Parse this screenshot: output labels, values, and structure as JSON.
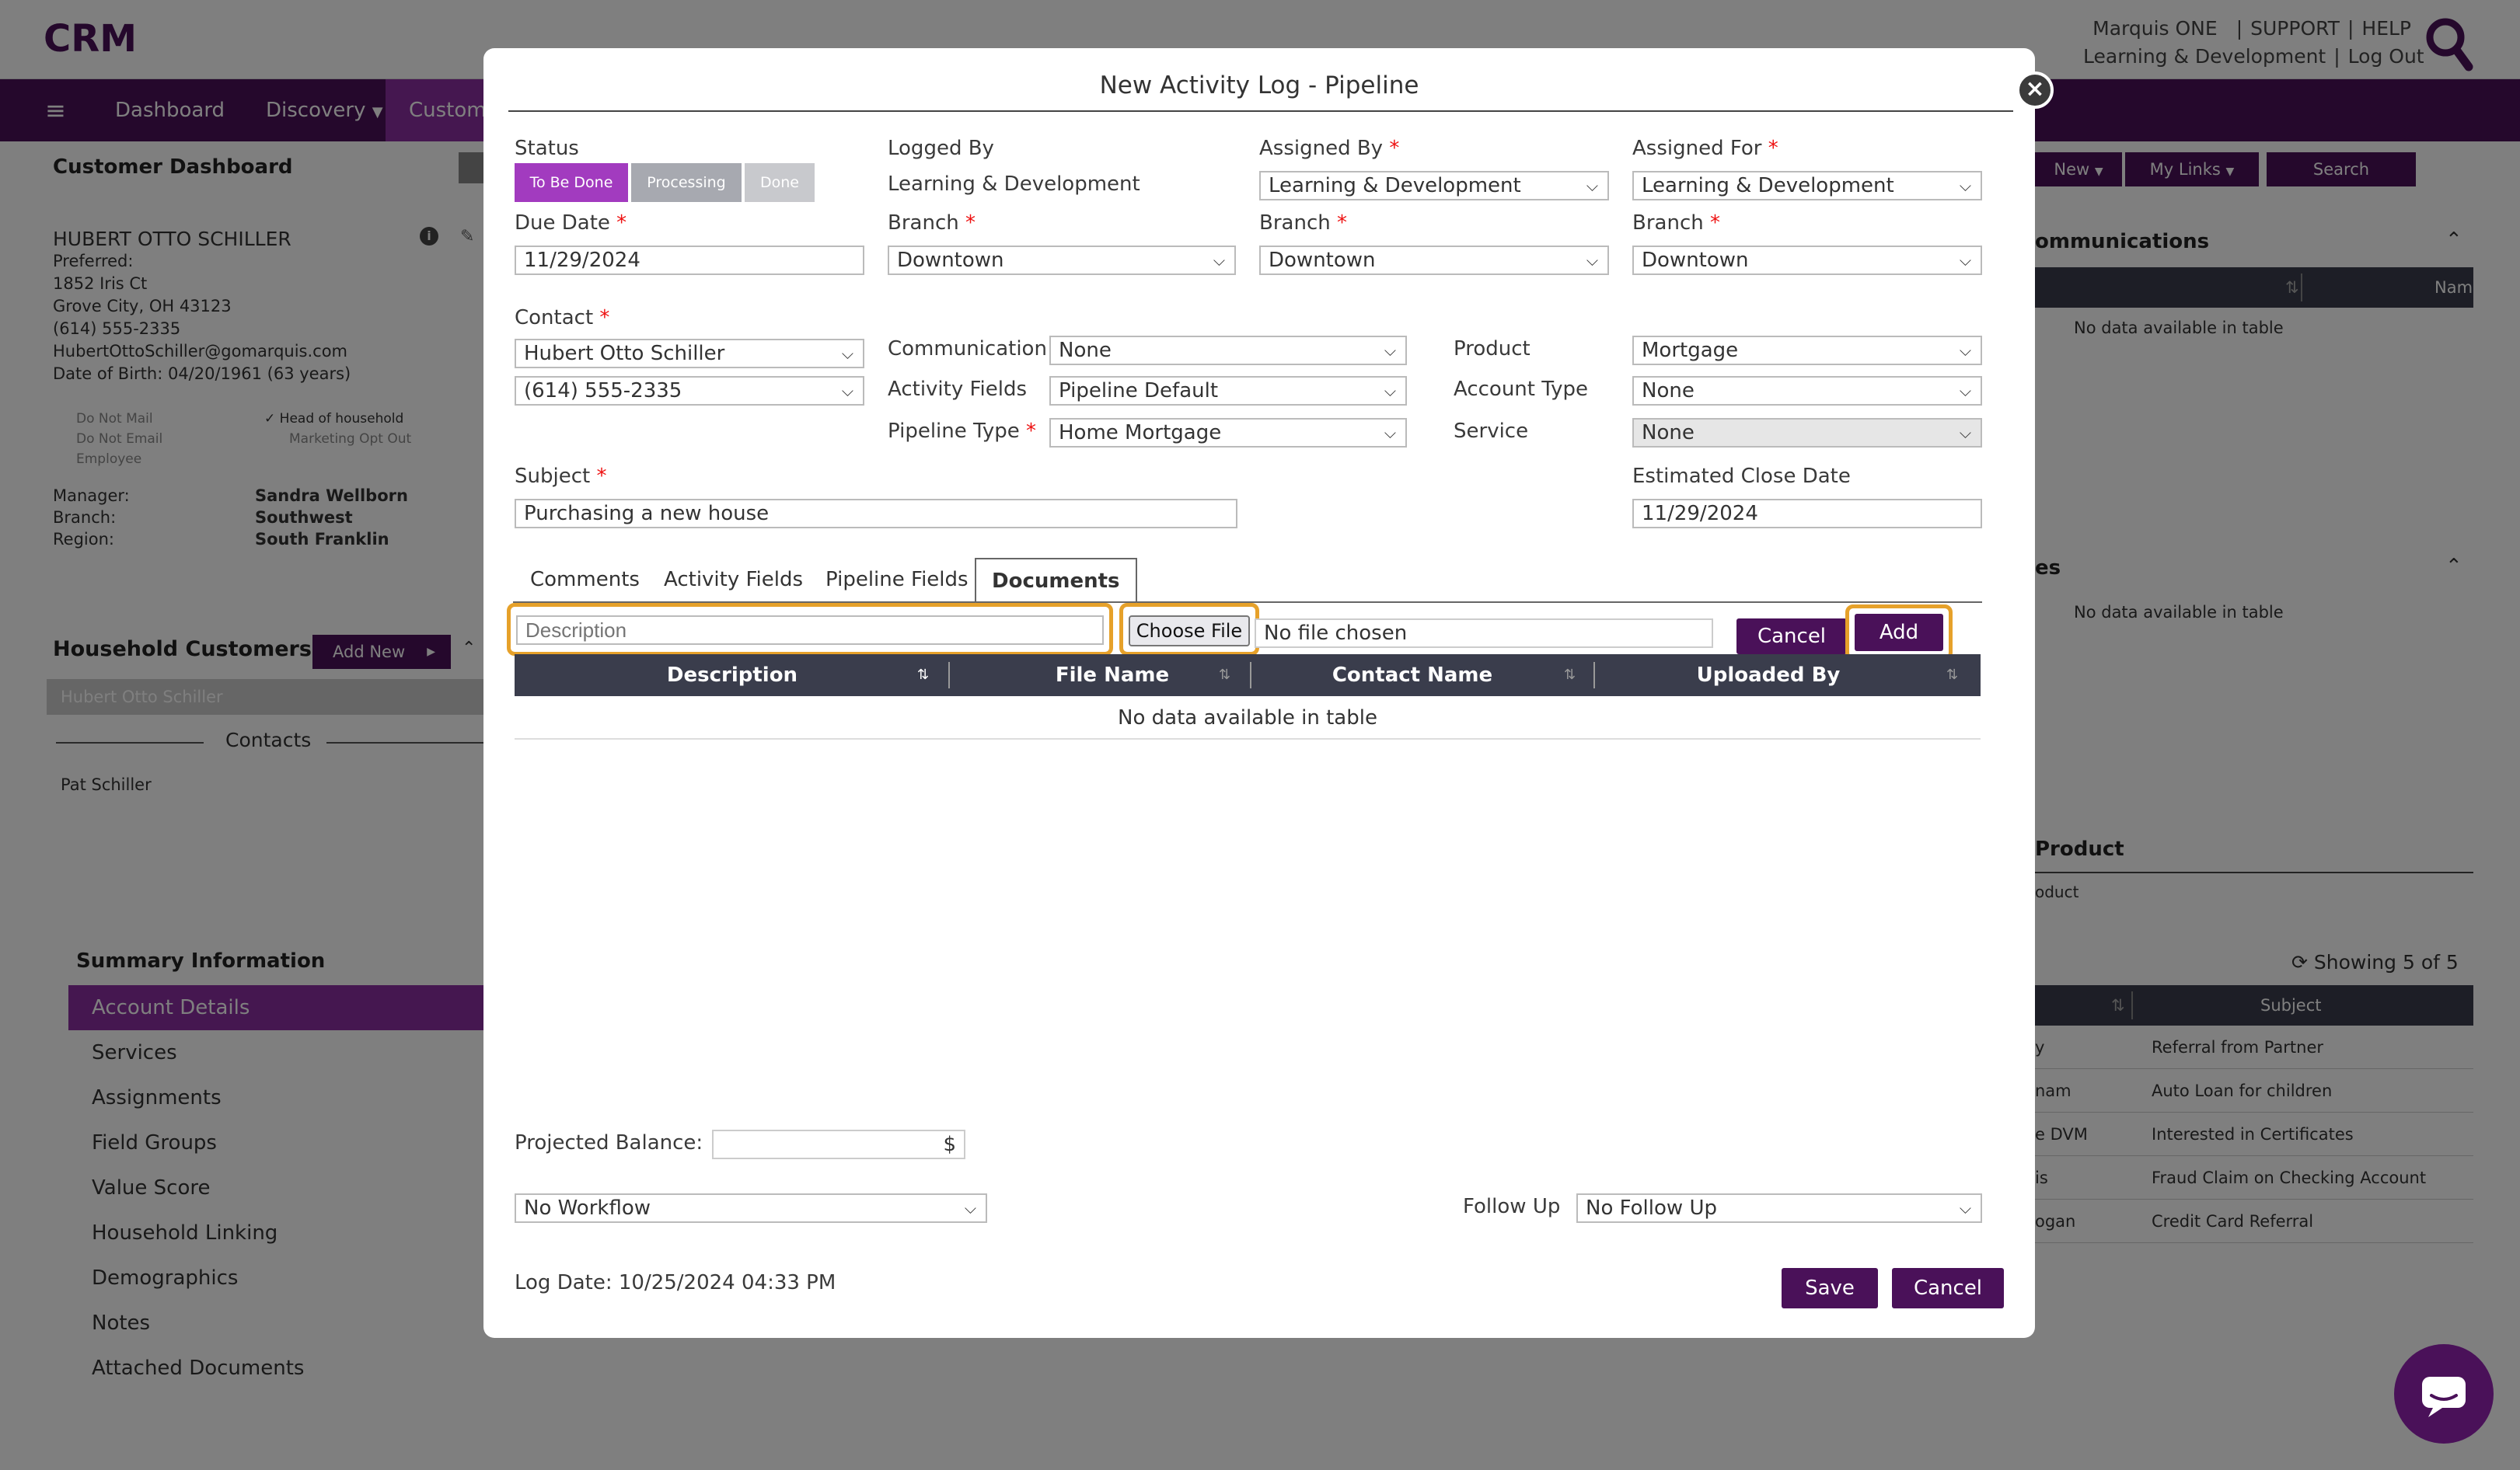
{
  "app": {
    "logo": "CRM",
    "brand": "marquis"
  },
  "top": {
    "user": "Marquis ONE",
    "support": "SUPPORT",
    "help": "HELP",
    "dept": "Learning & Development",
    "logout": "Log Out",
    "sep": "|"
  },
  "nav": {
    "dashboard": "Dashboard",
    "discovery": "Discovery",
    "customer": "Custome"
  },
  "dashboard": {
    "title": "Customer Dashboard",
    "customer": {
      "name": "HUBERT OTTO SCHILLER",
      "preferred": "Preferred:",
      "address1": "1852 Iris Ct",
      "address2": "Grove City, OH 43123",
      "phone": "(614) 555-2335",
      "email": "HubertOttoSchiller@gomarquis.com",
      "dob": "Date of Birth: 04/20/1961 (63 years)",
      "flags_left": [
        "Do Not Mail",
        "Do Not Email",
        "Employee"
      ],
      "flags_right": [
        "Head of household",
        "Marketing Opt Out"
      ],
      "manager_label": "Manager:",
      "manager": "Sandra Wellborn",
      "branch_label": "Branch:",
      "branch": "Southwest",
      "region_label": "Region:",
      "region": "South Franklin"
    },
    "household_title": "Household Customers",
    "add_new": "Add New",
    "household_member": "Hubert Otto Schiller",
    "contacts_label": "Contacts",
    "contact": "Pat Schiller",
    "summary_title": "Summary Information",
    "summary_items": [
      "Account Details",
      "Services",
      "Assignments",
      "Field Groups",
      "Value Score",
      "Household Linking",
      "Demographics",
      "Notes",
      "Attached Documents"
    ],
    "right": {
      "new_btn": "New",
      "links_btn": "My Links",
      "search_btn": "Search",
      "comm_title": "ommunications",
      "name_col": "Name",
      "no_data": "No data available in table",
      "section2": "es",
      "no_data2": "No data available in table",
      "product_title": "Product",
      "product_sub": "oduct",
      "showing": "Showing 5 of 5",
      "subject_col": "Subject",
      "rows": [
        {
          "left": "y",
          "subject": "Referral from Partner"
        },
        {
          "left": "nam",
          "subject": "Auto Loan for children"
        },
        {
          "left": "e DVM",
          "subject": "Interested in Certificates"
        },
        {
          "left": "is",
          "subject": "Fraud Claim on Checking Account"
        },
        {
          "left": "ogan",
          "subject": "Credit Card Referral"
        }
      ]
    }
  },
  "modal": {
    "title": "New Activity Log - Pipeline",
    "status_label": "Status",
    "status_options": [
      "To Be Done",
      "Processing",
      "Done"
    ],
    "logged_by_label": "Logged By",
    "logged_by": "Learning & Development",
    "assigned_by_label": "Assigned By",
    "assigned_by": "Learning & Development",
    "assigned_for_label": "Assigned For",
    "assigned_for": "Learning & Development",
    "due_date_label": "Due Date",
    "due_date": "11/29/2024",
    "branch_label": "Branch",
    "branch_logged": "Downtown",
    "branch_assigned_by": "Downtown",
    "branch_assigned_for": "Downtown",
    "contact_label": "Contact",
    "contact_name": "Hubert Otto Schiller",
    "contact_phone": "(614) 555-2335",
    "communication_label": "Communication",
    "communication": "None",
    "activity_fields_label": "Activity Fields",
    "activity_fields": "Pipeline Default",
    "pipeline_type_label": "Pipeline Type",
    "pipeline_type": "Home Mortgage",
    "product_label": "Product",
    "product": "Mortgage",
    "account_type_label": "Account Type",
    "account_type": "None",
    "service_label": "Service",
    "service": "None",
    "subject_label": "Subject",
    "subject": "Purchasing a new house",
    "est_close_label": "Estimated Close Date",
    "est_close": "11/29/2024",
    "tabs": [
      "Comments",
      "Activity Fields",
      "Pipeline Fields",
      "Documents"
    ],
    "doc_desc_placeholder": "Description",
    "choose_file": "Choose File",
    "no_file": "No file chosen",
    "cancel": "Cancel",
    "add": "Add",
    "table_cols": [
      "Description",
      "File Name",
      "Contact Name",
      "Uploaded By"
    ],
    "no_data": "No data available in table",
    "projected_balance_label": "Projected Balance:",
    "currency": "$",
    "workflow": "No Workflow",
    "follow_up_label": "Follow Up",
    "follow_up": "No Follow Up",
    "log_date": "Log Date: 10/25/2024 04:33 PM",
    "save": "Save",
    "cancel2": "Cancel",
    "required_mark": "*"
  }
}
